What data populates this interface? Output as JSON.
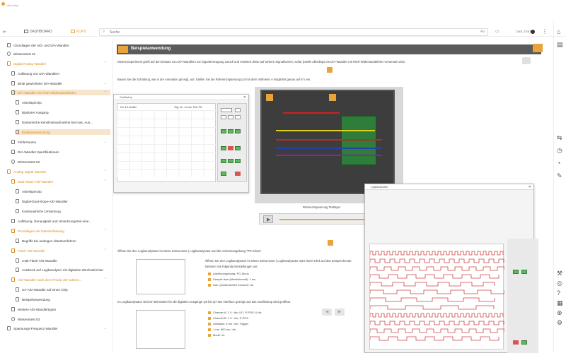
{
  "titlebar": {
    "app_name": "Libro App"
  },
  "nav": {
    "tabs": [
      {
        "label": "DASHBOARD"
      },
      {
        "label": "KURS"
      }
    ],
    "search_placeholder": "Suche",
    "aa_label": "Aa",
    "user": "DIGI_TEST"
  },
  "sidebar": {
    "items": [
      {
        "label": "Grundlagen der A/D- und D/A-Wandler"
      },
      {
        "label": "Wissenstest 01"
      },
      {
        "label": "Digital Analog Wandler"
      },
      {
        "label": "Auflösung von D/A-Wandlern"
      },
      {
        "label": "Binär gewichteter D/A-Wandler"
      },
      {
        "label": "D/A-Wandler mit R/2R-Widerstandsleiter"
      },
      {
        "label": "Arbeitsprinzip"
      },
      {
        "label": "Bipolarer Ausgang"
      },
      {
        "label": "Dynamische Kennlinienaufnahme bei mas..Aus..."
      },
      {
        "label": "Beispielanwendung"
      },
      {
        "label": "Fehlerraume"
      },
      {
        "label": "D/A-Wandler Spezifikationen"
      },
      {
        "label": "Wissenstest 02"
      },
      {
        "label": "Analog Digital Wandler"
      },
      {
        "label": "Dual-Slope-A/D-Wandler"
      },
      {
        "label": "Arbeitsprinzip"
      },
      {
        "label": "Digital-Dual-Slope-A/D-Wandler"
      },
      {
        "label": "Kontinuierliche Umsetzung"
      },
      {
        "label": "Auflösung, Genauigkeit und Umsetzungszeit eine..."
      },
      {
        "label": "Grundlagen der Datenerfassung"
      },
      {
        "label": "Begriffe bei analogen Abtastverfahren"
      },
      {
        "label": "Flash-A/D-Wandler"
      },
      {
        "label": "3-Bit-Flash-A/D-Wandler"
      },
      {
        "label": "Ausdruck auf Logikanalyser mit digitalem Wechselrichter"
      },
      {
        "label": "A/D-Wandler nach dem Prinzip der sukzes..."
      },
      {
        "label": "SA-A/D-Wandler auf einen Chip"
      },
      {
        "label": "Beispielanwendung"
      },
      {
        "label": "Weitere A/D-Wandlertypen"
      },
      {
        "label": "Wissenstest 03"
      },
      {
        "label": "Spannungs-Frequenz-Wandler"
      }
    ]
  },
  "content": {
    "section_title": "Beispielanwendung",
    "intro": "Dieses Experiment greift auf den Einsatz von D/A-Wandlern zur Signalerzeugung zurück und erweitert diese auf weitere Signalformen, wofür jeweils allerdings ein D/A-Wandler mit R/2R-Widerstandsleiter verwendet wird.",
    "step1": "Bauen Sie die Schaltung, wie in der Animation gezeigt, auf. Stellen Sie die Referenzspannung (U) mit dem Voltmeter A möglichst genau auf 8 V ein.",
    "slider_label": "Referenzspannung Testlayer",
    "step2": "Öffnen Sie den Logikanalysator im Menü Instrumente | Logikanalysator und die Actionsumgebung \"PG-Sinus\".",
    "step2_detail1": "Öffnen Sie den Logikanalysator im Menü Instrumente | Logikanalysator oder durch Klick auf das entsprechende",
    "step2_detail2": "Nehmen Sie folgende Einstellungen vor:",
    "settings": [
      {
        "label": "Arbeitsumgebung: PG-Sinus"
      },
      {
        "label": "Sample time (Messintervall): 1 ms"
      },
      {
        "label": "Kan. (kontinuierlich messen): an"
      }
    ],
    "step3": "Im Logikanalysator wird ein Bit-Muster für die digitalen Ausgänge Q0 bis Q7 des Interface gezeigt und das Oszilloskop wird geöffnet.",
    "channels": [
      {
        "label": "Channel A: 2 V / div; DC; P-POS: 0 div"
      },
      {
        "label": "Channel B: 2 V / div; P-POS"
      },
      {
        "label": "Zeitbasis: 5 ms / div; Trigger"
      },
      {
        "label": "1 ms: 500 ms / div"
      },
      {
        "label": "Mode: x/t"
      }
    ]
  },
  "scope_window": {
    "title": "Oszilloskop",
    "header_left": "Ch: 5.0 ms/Div",
    "header_right": "Trig: Ch. 1.0 ms, Pos: 0%"
  },
  "la_window": {
    "title": "Logikanalysator"
  }
}
